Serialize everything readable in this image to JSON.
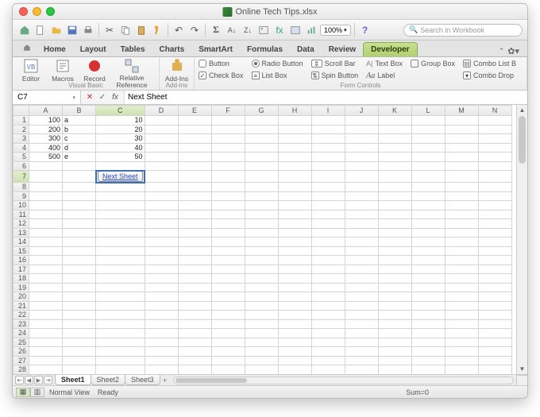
{
  "window": {
    "title": "Online Tech Tips.xlsx"
  },
  "toolbar": {
    "zoom": "100%",
    "search_placeholder": "Search in Workbook"
  },
  "ribbon_tabs": [
    "Home",
    "Layout",
    "Tables",
    "Charts",
    "SmartArt",
    "Formulas",
    "Data",
    "Review",
    "Developer"
  ],
  "active_tab": "Developer",
  "ribbon": {
    "vb_group": "Visual Basic",
    "editor": "Editor",
    "macros": "Macros",
    "record": "Record",
    "relref": "Relative Reference",
    "addins_group": "Add-Ins",
    "addins": "Add-Ins",
    "fc_group": "Form Controls",
    "button": "Button",
    "radio": "Radio Button",
    "scroll": "Scroll Bar",
    "textbox": "Text Box",
    "groupbox": "Group Box",
    "combolist": "Combo List B",
    "checkbox": "Check Box",
    "listbox": "List Box",
    "spin": "Spin Button",
    "label": "Label",
    "combodrop": "Combo Drop"
  },
  "formula_bar": {
    "name": "C7",
    "value": "Next Sheet"
  },
  "columns": [
    "A",
    "B",
    "C",
    "D",
    "E",
    "F",
    "G",
    "H",
    "I",
    "J",
    "K",
    "L",
    "M",
    "N"
  ],
  "rows": 33,
  "selected": {
    "col": "C",
    "row": 7
  },
  "cells": {
    "A1": "100",
    "B1": "a",
    "C1": "10",
    "A2": "200",
    "B2": "b",
    "C2": "20",
    "A3": "300",
    "B3": "c",
    "C3": "30",
    "A4": "400",
    "B4": "d",
    "C4": "40",
    "A5": "500",
    "B5": "e",
    "C5": "50"
  },
  "macro_button": {
    "row": 7,
    "col": "C",
    "label": "Next Sheet"
  },
  "sheet_tabs": [
    "Sheet1",
    "Sheet2",
    "Sheet3"
  ],
  "active_sheet": "Sheet1",
  "status": {
    "view": "Normal View",
    "state": "Ready",
    "sum": "Sum=0"
  }
}
